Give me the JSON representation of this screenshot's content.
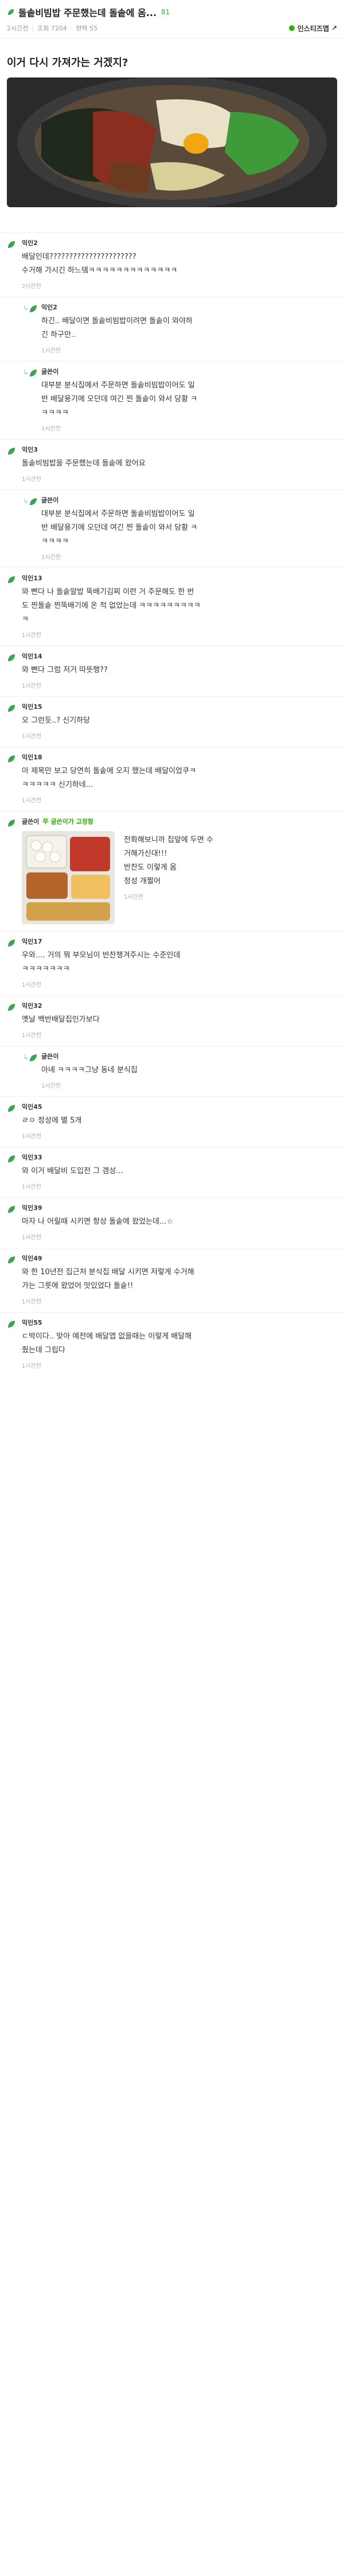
{
  "post": {
    "title": "돌솥비빔밥 주문했는데 돌솥에 옴...",
    "title_count": "81",
    "time": "2시간전",
    "views": "조회 7204",
    "recommend": "현택 55",
    "insta_label": "인스티즈앱",
    "headline": "이거 다시 가져가는 거겠지?"
  },
  "colors": {
    "accent": "#2db400",
    "brand_count": "#3aa655"
  },
  "comments": [
    {
      "nick": "익인2",
      "lines": [
        "배달인데??????????????????????",
        "수거해 가시긴 하느뎈ㅋㅋㅋㅋㅋㅋㅋㅋㅋㅋㅋㅋㅋ"
      ],
      "time": "2시간전",
      "reply": false
    },
    {
      "nick": "익인2",
      "lines": [
        "하긴.. 배달이면 돌솥비빔밥이려면 돌솥이 와야하",
        "긴 하구만.."
      ],
      "time": "1시간전",
      "reply": true
    },
    {
      "nick": "글쓴이",
      "lines": [
        "대부분 분식집에서 주문하면 돌솥비빔밥이어도 일",
        "반 배달용기에 오던데 여긴 찐 돌솥이 와서 당황 ㅋ",
        "ㅋㅋㅋㅋ"
      ],
      "time": "1시간전",
      "reply": true
    },
    {
      "nick": "익인3",
      "lines": [
        "돌솥비빔밥을 주문했는데 돌솥에 왔어요"
      ],
      "time": "1시간전",
      "reply": false
    },
    {
      "nick": "글쓴이",
      "lines": [
        "대부분 분식집에서 주문하면 돌솥비빔밥이어도 일",
        "반 배달용기에 오던데 여긴 찐 돌솥이 와서 당황 ㅋ",
        "ㅋㅋㅋㅋ"
      ],
      "time": "1시간전",
      "reply": true
    },
    {
      "nick": "익인13",
      "lines": [
        "와 뻔다 나 돌솥알밥 뚝배기김찌 이런 거 주문해도 한 번",
        "도 찐돌솥 찐뚝배기에 온 적 없었는데 ㅋㅋㅋㅋㅋㅋㅋㅋㅋ",
        "ㅋ"
      ],
      "time": "1시간전",
      "reply": false
    },
    {
      "nick": "익인14",
      "lines": [
        "와 뻔다 그럼 저거 따뜻행??"
      ],
      "time": "1시간전",
      "reply": false
    },
    {
      "nick": "익인15",
      "lines": [
        "오 그런듯..? 신기하당"
      ],
      "time": "1시간전",
      "reply": false
    },
    {
      "nick": "익인18",
      "lines": [
        "아 제목만 보고 당연히 돌솥에 오지 했는데 배달이었쿠ㅋ",
        "ㅋㅋㅋㅋㅋ 신기하네..."
      ],
      "time": "1시간전",
      "reply": false
    }
  ],
  "media_comment": {
    "nick": "글쓴이",
    "badge": "쭈 글쓴이가 고정함",
    "lines": [
      "전화해보니까 집앞에 두면 수",
      "거해가신대!!!",
      "반찬도 이렇게 옴",
      "정성 개쩔어"
    ],
    "time": "1시간전"
  },
  "comments2": [
    {
      "nick": "익인17",
      "lines": [
        "우와.... 거의 뭐 부모님이 반찬챙겨주시는 수준인데",
        "ㅋㅋㅋㅋㅋㅋㅋ"
      ],
      "time": "1시간전",
      "reply": false
    },
    {
      "nick": "익인32",
      "lines": [
        "옛날 백반배달집인가보다"
      ],
      "time": "1시간전",
      "reply": false
    },
    {
      "nick": "글쓴이",
      "lines": [
        "아녜 ㅋㅋㅋㅋ그냥 동네 분식집"
      ],
      "time": "1시간전",
      "reply": true
    },
    {
      "nick": "익인45",
      "lines": [
        "ㄹㅇ 정성에 별 5개"
      ],
      "time": "1시간전",
      "reply": false
    },
    {
      "nick": "익인33",
      "lines": [
        "와 이거 배달비 도입전 그 갬성..."
      ],
      "time": "1시간전",
      "reply": false
    },
    {
      "nick": "익인39",
      "lines": [
        "마자 나 어릴때 시키면 항상 돌솥에 왔었는데...☆"
      ],
      "time": "1시간전",
      "reply": false
    },
    {
      "nick": "익인49",
      "lines": [
        "와 한 10년전 집근처 분식집 배달 시키면 저렇게 수거해",
        "가는 그릇에 왔었어 맛있었다 돌솥!!"
      ],
      "time": "1시간전",
      "reply": false
    },
    {
      "nick": "익인55",
      "lines": [
        "ㄷ박이다.. 맞아 예전에 배달앱 없을때는 이렇게 배달해",
        "줬는데 그립다"
      ],
      "time": "1시간전",
      "reply": false
    }
  ]
}
